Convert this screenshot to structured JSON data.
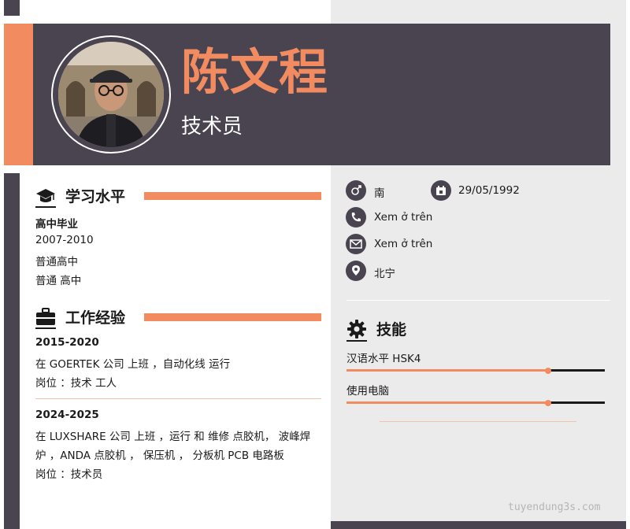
{
  "header": {
    "name": "陈文程",
    "role": "技术员"
  },
  "education": {
    "title": "学习水平",
    "items": [
      {
        "degree": "高中毕业",
        "years": "2007-2010",
        "school": "普通高中",
        "major": "普通 高中"
      }
    ]
  },
  "experience": {
    "title": "工作经验",
    "items": [
      {
        "years": "2015-2020",
        "lines": [
          "在  GOERTEK 公司 上班 ，自动化线 运行",
          "岗位 ：技术 工人"
        ]
      },
      {
        "years": "2024-2025",
        "lines": [
          "在 LUXSHARE 公司 上班  ，运行 和 维修 点胶机， 波峰焊",
          "炉 ，ANDA 点胶机 ， 保压机 ， 分板机 PCB 电路板",
          "岗位 ：技术员"
        ]
      }
    ]
  },
  "info": {
    "gender": "南",
    "birthday": "29/05/1992",
    "phone": "Xem ở trên",
    "email": "Xem ở trên",
    "address": "北宁"
  },
  "skills": {
    "title": "技能",
    "items": [
      {
        "name": "汉语水平 HSK4",
        "level": 0.78
      },
      {
        "name": "使用电脑",
        "level": 0.78
      }
    ]
  },
  "watermark": "tuyendung3s.com",
  "colors": {
    "accent": "#f28c60",
    "dark": "#4a4451",
    "panel": "#ebebeb"
  },
  "icons": [
    "graduation-cap-icon",
    "briefcase-icon",
    "gender-icon",
    "calendar-icon",
    "phone-icon",
    "email-icon",
    "location-icon",
    "gear-icon"
  ]
}
